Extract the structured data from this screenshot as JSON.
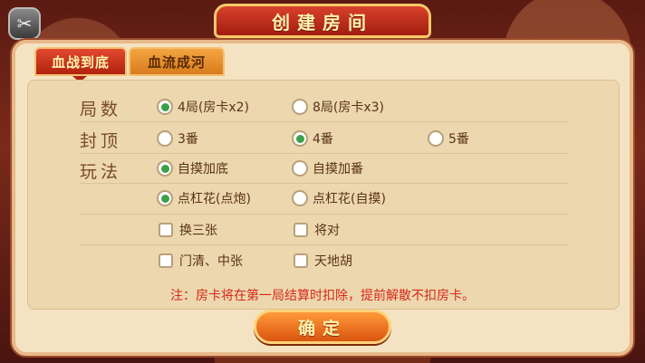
{
  "title": "创建房间",
  "tabs": [
    {
      "label": "血战到底",
      "active": true
    },
    {
      "label": "血流成河",
      "active": false
    }
  ],
  "rows": {
    "rounds": {
      "label": "局数",
      "options": [
        {
          "text": "4局(房卡x2)",
          "selected": true
        },
        {
          "text": "8局(房卡x3)",
          "selected": false
        }
      ]
    },
    "cap": {
      "label": "封顶",
      "options": [
        {
          "text": "3番",
          "selected": false
        },
        {
          "text": "4番",
          "selected": true
        },
        {
          "text": "5番",
          "selected": false
        }
      ]
    },
    "play": {
      "label": "玩法",
      "radio_row1": [
        {
          "text": "自摸加底",
          "selected": true
        },
        {
          "text": "自摸加番",
          "selected": false
        }
      ],
      "radio_row2": [
        {
          "text": "点杠花(点炮)",
          "selected": true
        },
        {
          "text": "点杠花(自摸)",
          "selected": false
        }
      ],
      "checks": [
        {
          "text": "换三张",
          "checked": false
        },
        {
          "text": "将对",
          "checked": false
        },
        {
          "text": "门清、中张",
          "checked": false
        },
        {
          "text": "天地胡",
          "checked": false
        }
      ]
    }
  },
  "note": "注：房卡将在第一局结算时扣除，提前解散不扣房卡。",
  "confirm_label": "确定",
  "colors": {
    "accent_red": "#d8291a",
    "radio_green": "#3aa04a",
    "panel_bg": "#f4e3c2"
  }
}
